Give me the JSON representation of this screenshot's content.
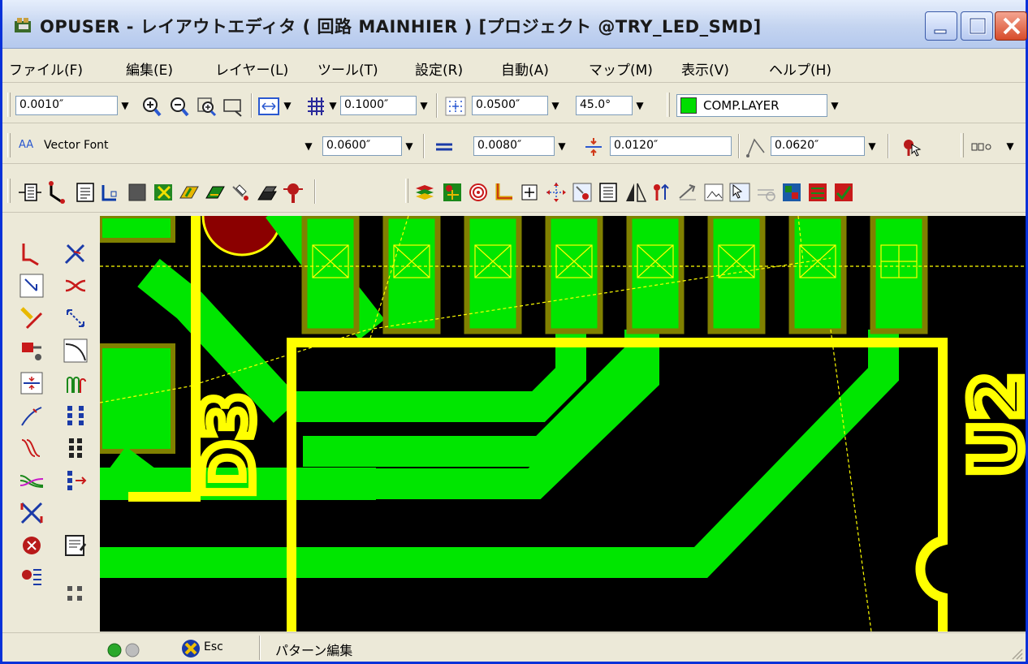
{
  "window": {
    "title": "OPUSER - レイアウトエディタ ( 回路 MAINHIER ) [プロジェクト @TRY_LED_SMD]"
  },
  "menu": [
    "ファイル(F)",
    "編集(E)",
    "レイヤー(L)",
    "ツール(T)",
    "設定(R)",
    "自動(A)",
    "マップ(M)",
    "表示(V)",
    "ヘルプ(H)"
  ],
  "toolbar1": {
    "snap_value": "0.0010″",
    "grid_value": "0.1000″",
    "via_grid_value": "0.0500″",
    "angle_value": "45.0°",
    "layer_name": "COMP.LAYER",
    "layer_color": "#00dd00"
  },
  "toolbar2": {
    "font_name": "Vector Font",
    "font_size": "0.0600″",
    "line_width": "0.0080″",
    "clearance": "0.0120″",
    "arc_size": "0.0620″",
    "font_icon_label": "AA"
  },
  "canvas": {
    "ref_d3": "D3",
    "ref_u2": "U2",
    "colors": {
      "background": "#000000",
      "trace": "#00e600",
      "silk": "#ffff00",
      "pad_outline": "#808000",
      "pad_fill": "#00e600"
    }
  },
  "statusbar": {
    "esc_label": "Esc",
    "mode_text": "パターン編集"
  }
}
